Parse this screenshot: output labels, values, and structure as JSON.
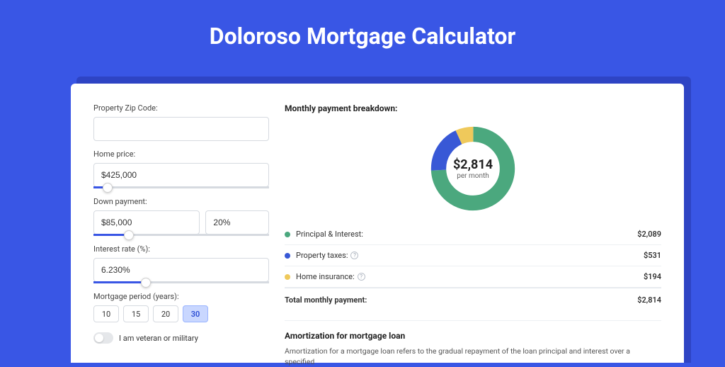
{
  "title": "Doloroso Mortgage Calculator",
  "form": {
    "zip_label": "Property Zip Code:",
    "zip_value": "",
    "home_price_label": "Home price:",
    "home_price_value": "$425,000",
    "down_payment_label": "Down payment:",
    "down_payment_value": "$85,000",
    "down_payment_pct": "20%",
    "interest_label": "Interest rate (%):",
    "interest_value": "6.230%",
    "period_label": "Mortgage period (years):",
    "periods": [
      "10",
      "15",
      "20",
      "30"
    ],
    "period_selected": "30",
    "veteran_label": "I am veteran or military"
  },
  "breakdown": {
    "title": "Monthly payment breakdown:",
    "total_value": "$2,814",
    "total_sub": "per month",
    "items": [
      {
        "label": "Principal & Interest:",
        "value": "$2,089",
        "color": "#4ba87e",
        "help": false
      },
      {
        "label": "Property taxes:",
        "value": "$531",
        "color": "#3858d6",
        "help": true
      },
      {
        "label": "Home insurance:",
        "value": "$194",
        "color": "#efc95b",
        "help": true
      }
    ],
    "total_label": "Total monthly payment:",
    "total_amount": "$2,814"
  },
  "chart_data": {
    "type": "pie",
    "title": "Monthly payment breakdown",
    "series": [
      {
        "name": "Principal & Interest",
        "value": 2089,
        "color": "#4ba87e"
      },
      {
        "name": "Property taxes",
        "value": 531,
        "color": "#3858d6"
      },
      {
        "name": "Home insurance",
        "value": 194,
        "color": "#efc95b"
      }
    ],
    "total": 2814
  },
  "amort": {
    "title": "Amortization for mortgage loan",
    "text": "Amortization for a mortgage loan refers to the gradual repayment of the loan principal and interest over a specified"
  }
}
